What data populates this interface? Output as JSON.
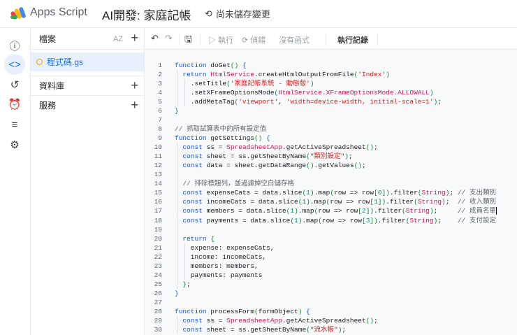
{
  "header": {
    "app_name": "Apps Script",
    "project_title": "AI開發: 家庭記帳",
    "save_status": "尚未儲存變更"
  },
  "rail": [
    {
      "name": "info-icon",
      "glyph": "ⓘ"
    },
    {
      "name": "code-icon",
      "glyph": "<>"
    },
    {
      "name": "history-icon",
      "glyph": "↺"
    },
    {
      "name": "triggers-icon",
      "glyph": "⏰"
    },
    {
      "name": "executions-icon",
      "glyph": "≡"
    },
    {
      "name": "settings-icon",
      "glyph": "⚙"
    }
  ],
  "files": {
    "header": "檔案",
    "sort_label": "AZ",
    "items": [
      {
        "name": "程式碼.gs"
      }
    ],
    "libraries": "資料庫",
    "services": "服務"
  },
  "toolbar": {
    "run": "執行",
    "debug": "偵錯",
    "no_function": "沒有函式",
    "execution_log": "執行記錄"
  },
  "colors": {
    "accent": "#1a73e8",
    "keyword": "#1a56c9",
    "class": "#c2185b",
    "string": "#c5221f"
  },
  "code": [
    {
      "n": "1",
      "i": 0,
      "t": [
        [
          "kw",
          "function"
        ],
        [
          "t",
          " doGet"
        ],
        [
          "p",
          "()"
        ],
        [
          "t",
          " "
        ],
        [
          "b",
          "{"
        ]
      ]
    },
    {
      "n": "2",
      "i": 1,
      "t": [
        [
          "t",
          "  "
        ],
        [
          "kw",
          "return"
        ],
        [
          "t",
          " "
        ],
        [
          "cls",
          "HtmlService"
        ],
        [
          "t",
          ".createHtmlOutputFromFile"
        ],
        [
          "p",
          "("
        ],
        [
          "str",
          "'Index'"
        ],
        [
          "p",
          ")"
        ]
      ]
    },
    {
      "n": "3",
      "i": 2,
      "t": [
        [
          "t",
          "    .setTitle"
        ],
        [
          "p",
          "("
        ],
        [
          "str",
          "'家庭記帳系統 - 動態版'"
        ],
        [
          "p",
          ")"
        ]
      ]
    },
    {
      "n": "4",
      "i": 2,
      "t": [
        [
          "t",
          "    .setXFrameOptionsMode"
        ],
        [
          "p",
          "("
        ],
        [
          "cls",
          "HtmlService.XFrameOptionsMode.ALLOWALL"
        ],
        [
          "p",
          ")"
        ]
      ]
    },
    {
      "n": "5",
      "i": 2,
      "t": [
        [
          "t",
          "    .addMetaTag"
        ],
        [
          "p",
          "("
        ],
        [
          "str",
          "'viewport'"
        ],
        [
          "t",
          ", "
        ],
        [
          "str",
          "'width=device-width, initial-scale=1'"
        ],
        [
          "p",
          ")"
        ],
        [
          "t",
          ";"
        ]
      ]
    },
    {
      "n": "6",
      "i": 0,
      "t": [
        [
          "b",
          "}"
        ]
      ]
    },
    {
      "n": "7",
      "i": 0,
      "t": []
    },
    {
      "n": "8",
      "i": 0,
      "t": [
        [
          "cm",
          "// 抓取試算表中的所有設定值"
        ]
      ]
    },
    {
      "n": "9",
      "i": 0,
      "t": [
        [
          "kw",
          "function"
        ],
        [
          "t",
          " getSettings"
        ],
        [
          "p",
          "()"
        ],
        [
          "t",
          " "
        ],
        [
          "b",
          "{"
        ]
      ]
    },
    {
      "n": "10",
      "i": 1,
      "t": [
        [
          "t",
          "  "
        ],
        [
          "kw",
          "const"
        ],
        [
          "t",
          " ss = "
        ],
        [
          "cls",
          "SpreadsheetApp"
        ],
        [
          "t",
          ".getActiveSpreadsheet"
        ],
        [
          "p",
          "()"
        ],
        [
          "t",
          ";"
        ]
      ]
    },
    {
      "n": "11",
      "i": 1,
      "t": [
        [
          "t",
          "  "
        ],
        [
          "kw",
          "const"
        ],
        [
          "t",
          " sheet = ss.getSheetByName"
        ],
        [
          "p",
          "("
        ],
        [
          "str",
          "\"類別設定\""
        ],
        [
          "p",
          ")"
        ],
        [
          "t",
          ";"
        ]
      ]
    },
    {
      "n": "12",
      "i": 1,
      "t": [
        [
          "t",
          "  "
        ],
        [
          "kw",
          "const"
        ],
        [
          "t",
          " data = sheet.getDataRange"
        ],
        [
          "p",
          "()"
        ],
        [
          "t",
          ".getValues"
        ],
        [
          "p",
          "()"
        ],
        [
          "t",
          ";"
        ]
      ]
    },
    {
      "n": "13",
      "i": 1,
      "t": []
    },
    {
      "n": "14",
      "i": 1,
      "t": [
        [
          "t",
          "  "
        ],
        [
          "cm",
          "// 排除標題列，並過濾掉空白儲存格"
        ]
      ]
    },
    {
      "n": "15",
      "i": 1,
      "t": [
        [
          "t",
          "  "
        ],
        [
          "kw",
          "const"
        ],
        [
          "t",
          " expenseCats = data.slice"
        ],
        [
          "p",
          "("
        ],
        [
          "num",
          "1"
        ],
        [
          "p",
          ")"
        ],
        [
          "t",
          ".map"
        ],
        [
          "p",
          "("
        ],
        [
          "t",
          "row => row"
        ],
        [
          "p",
          "["
        ],
        [
          "num",
          "0"
        ],
        [
          "p",
          "])"
        ],
        [
          "t",
          ".filter"
        ],
        [
          "p",
          "("
        ],
        [
          "cls",
          "String"
        ],
        [
          "p",
          ")"
        ],
        [
          "t",
          "; "
        ],
        [
          "cm",
          "// 支出類別"
        ]
      ]
    },
    {
      "n": "16",
      "i": 1,
      "t": [
        [
          "t",
          "  "
        ],
        [
          "kw",
          "const"
        ],
        [
          "t",
          " incomeCats = data.slice"
        ],
        [
          "p",
          "("
        ],
        [
          "num",
          "1"
        ],
        [
          "p",
          ")"
        ],
        [
          "t",
          ".map"
        ],
        [
          "p",
          "("
        ],
        [
          "t",
          "row => row"
        ],
        [
          "p",
          "["
        ],
        [
          "num",
          "1"
        ],
        [
          "p",
          "])"
        ],
        [
          "t",
          ".filter"
        ],
        [
          "p",
          "("
        ],
        [
          "cls",
          "String"
        ],
        [
          "p",
          ")"
        ],
        [
          "t",
          ";  "
        ],
        [
          "cm",
          "// 收入類別"
        ]
      ]
    },
    {
      "n": "17",
      "i": 1,
      "t": [
        [
          "t",
          "  "
        ],
        [
          "kw",
          "const"
        ],
        [
          "t",
          " members = data.slice"
        ],
        [
          "p",
          "("
        ],
        [
          "num",
          "1"
        ],
        [
          "p",
          ")"
        ],
        [
          "t",
          ".map"
        ],
        [
          "p",
          "("
        ],
        [
          "t",
          "row => row"
        ],
        [
          "p",
          "["
        ],
        [
          "num",
          "2"
        ],
        [
          "p",
          "])"
        ],
        [
          "t",
          ".filter"
        ],
        [
          "p",
          "("
        ],
        [
          "cls",
          "String"
        ],
        [
          "p",
          ")"
        ],
        [
          "t",
          ";     "
        ],
        [
          "cm",
          "// 成員名單"
        ]
      ]
    },
    {
      "n": "18",
      "i": 1,
      "t": [
        [
          "t",
          "  "
        ],
        [
          "kw",
          "const"
        ],
        [
          "t",
          " payments = data.slice"
        ],
        [
          "p",
          "("
        ],
        [
          "num",
          "1"
        ],
        [
          "p",
          ")"
        ],
        [
          "t",
          ".map"
        ],
        [
          "p",
          "("
        ],
        [
          "t",
          "row => row"
        ],
        [
          "p",
          "["
        ],
        [
          "num",
          "3"
        ],
        [
          "p",
          "])"
        ],
        [
          "t",
          ".filter"
        ],
        [
          "p",
          "("
        ],
        [
          "cls",
          "String"
        ],
        [
          "p",
          ")"
        ],
        [
          "t",
          ";    "
        ],
        [
          "cm",
          "// 支付設定"
        ]
      ]
    },
    {
      "n": "19",
      "i": 1,
      "t": []
    },
    {
      "n": "20",
      "i": 1,
      "t": [
        [
          "t",
          "  "
        ],
        [
          "kw",
          "return"
        ],
        [
          "t",
          " "
        ],
        [
          "p",
          "{"
        ]
      ]
    },
    {
      "n": "21",
      "i": 2,
      "t": [
        [
          "t",
          "    expense: expenseCats,"
        ]
      ]
    },
    {
      "n": "22",
      "i": 2,
      "t": [
        [
          "t",
          "    income: incomeCats,"
        ]
      ]
    },
    {
      "n": "23",
      "i": 2,
      "t": [
        [
          "t",
          "    members: members,"
        ]
      ]
    },
    {
      "n": "24",
      "i": 2,
      "t": [
        [
          "t",
          "    payments: payments"
        ]
      ]
    },
    {
      "n": "25",
      "i": 1,
      "t": [
        [
          "t",
          "  "
        ],
        [
          "p",
          "}"
        ],
        [
          "t",
          ";"
        ]
      ]
    },
    {
      "n": "26",
      "i": 0,
      "t": [
        [
          "b",
          "}"
        ]
      ]
    },
    {
      "n": "27",
      "i": 0,
      "t": []
    },
    {
      "n": "28",
      "i": 0,
      "t": [
        [
          "kw",
          "function"
        ],
        [
          "t",
          " processForm"
        ],
        [
          "p",
          "("
        ],
        [
          "t",
          "formObject"
        ],
        [
          "p",
          ")"
        ],
        [
          "t",
          " "
        ],
        [
          "b",
          "{"
        ]
      ]
    },
    {
      "n": "29",
      "i": 1,
      "t": [
        [
          "t",
          "  "
        ],
        [
          "kw",
          "const"
        ],
        [
          "t",
          " ss = "
        ],
        [
          "cls",
          "SpreadsheetApp"
        ],
        [
          "t",
          ".getActiveSpreadsheet"
        ],
        [
          "p",
          "()"
        ],
        [
          "t",
          ";"
        ]
      ]
    },
    {
      "n": "30",
      "i": 1,
      "t": [
        [
          "t",
          "  "
        ],
        [
          "kw",
          "const"
        ],
        [
          "t",
          " sheet = ss.getSheetByName"
        ],
        [
          "p",
          "("
        ],
        [
          "str",
          "\"流水帳\""
        ],
        [
          "p",
          ")"
        ],
        [
          "t",
          ";"
        ]
      ]
    }
  ]
}
